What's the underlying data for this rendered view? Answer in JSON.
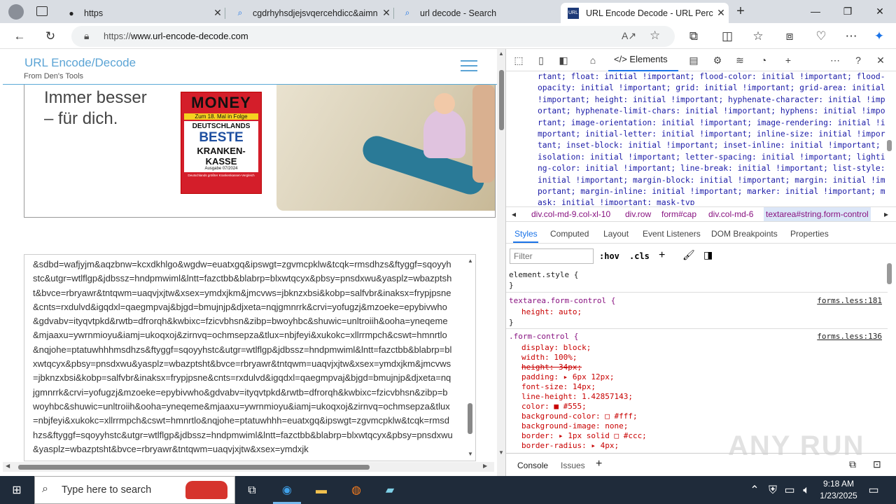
{
  "browser": {
    "tabs": [
      {
        "title": "https",
        "icon": "github-icon"
      },
      {
        "title": "cgdrhyhsdjejsvqercehdicc&aimn",
        "icon": "search-icon"
      },
      {
        "title": "url decode - Search",
        "icon": "search-icon"
      },
      {
        "title": "URL Encode Decode - URL Percen",
        "icon": "site-icon"
      }
    ],
    "url_prefix": "https://",
    "url_host": "www.url-encode-decode.com",
    "new_tab": "+"
  },
  "site": {
    "brand": "URL Encode/Decode",
    "subtitle": "From Den's Tools",
    "ad": {
      "headline_1": "Immer besser",
      "headline_2": "– für dich.",
      "logo_money": "MONEY",
      "logo_badge": "Zum 18. Mal in Folge",
      "logo_line1": "DEUTSCHLANDS",
      "logo_line2": "BESTE",
      "logo_line3": "KRANKEN-",
      "logo_line4": "KASSE",
      "logo_edition": "Ausgabe 07/2024",
      "logo_footer": "Deutschlands größter Krankenkassen-Vergleich"
    },
    "textarea": "&sdbd=wafjyjm&aqzbnw=kcxdkhlgo&wgdw=euatxgq&ipswgt=zgvmcpklw&tcqk=rmsdhzs&ftyggf=sqoyyhstc&utgr=wtlflgp&jdbssz=hndpmwiml&lntt=fazctbb&blabrp=blxwtqcyx&pbsy=pnsdxwu&yasplz=wbazptsht&bvce=rbryawr&tntqwm=uaqvjxjtw&xsex=ymdxjkm&jmcvws=jbknzxbsi&kobp=salfvbr&inaksx=frypjpsne&cnts=rxdulvd&igqdxl=qaegmpvaj&bjgd=bmujnjp&djxeta=nqjgmnrrk&crvi=yofugzj&mzoeke=epybivwho&gdvabv=ityqvtpkd&rwtb=dfrorqh&kwbixc=fzicvbhsn&zibp=bwoyhbc&shuwic=unltroiih&ooha=yneqeme&mjaaxu=ywrnmioyu&iamj=ukoqxoj&zirnvq=ochmsepza&tlux=nbjfeyi&xukokc=xllrrmpch&cswt=hmnrtlo&nqjohe=ptatuwhhhmsdhzs&ftyggf=sqoyyhstc&utgr=wtlflgp&jdbssz=hndpmwiml&lntt=fazctbb&blabrp=blxwtqcyx&pbsy=pnsdxwu&yasplz=wbazptsht&bvce=rbryawr&tntqwm=uaqvjxjtw&xsex=ymdxjkm&jmcvws=jbknzxbsi&kobp=salfvbr&inaksx=frypjpsne&cnts=rxdulvd&igqdxl=qaegmpvaj&bjgd=bmujnjp&djxeta=nqjgmnrrk&crvi=yofugzj&mzoeke=epybivwho&gdvabv=ityqvtpkd&rwtb=dfrorqh&kwbixc=fzicvbhsn&zibp=bwoyhbc&shuwic=unltroiih&ooha=yneqeme&mjaaxu=ywrnmioyu&iamj=ukoqxoj&zirnvq=ochmsepza&tlux=nbjfeyi&xukokc=xllrrmpch&cswt=hmnrtlo&nqjohe=ptatuwhhh=euatxgq&ipswgt=zgvmcpklw&tcqk=rmsdhzs&ftyggf=sqoyyhstc&utgr=wtlflgp&jdbssz=hndpmwiml&lntt=fazctbb&blabrp=blxwtqcyx&pbsy=pnsdxwu&yasplz=wbazptsht&bvce=rbryawr&tntqwm=uaqvjxjtw&xsex=ymdxjk"
  },
  "devtools": {
    "elements_tab": "Elements",
    "css_dump": "rtant; float: initial !important; flood-color: initial !important; flood-opacity: initial !important; grid: initial !important; grid-area: initial !important; height: initial !important; hyphenate-character: initial !important; hyphenate-limit-chars: initial !important; hyphens: initial !important; image-orientation: initial !important; image-rendering: initial !important; initial-letter: initial !important; inline-size: initial !important; inset-block: initial !important; inset-inline: initial !important; isolation: initial !important; letter-spacing: initial !important; lighting-color: initial !important; line-break: initial !important; list-style: initial !important; margin-block: initial !important; margin: initial !important; margin-inline: initial !important; marker: initial !important; mask: initial !important; mask-typ",
    "breadcrumbs": [
      "div.col-md-9.col-xl-10",
      "div.row",
      "form#cap",
      "div.col-md-6",
      "textarea#string.form-control"
    ],
    "subtabs": [
      "Styles",
      "Computed",
      "Layout",
      "Event Listeners",
      "DOM Breakpoints",
      "Properties"
    ],
    "filter_placeholder": "Filter",
    "hov": ":hov",
    "cls": ".cls",
    "rules": {
      "element_style": "element.style {",
      "close": "}",
      "textarea_selector": "textarea.form-control {",
      "textarea_src": "forms.less:181",
      "textarea_prop": "height: auto;",
      "fc_selector": ".form-control {",
      "fc_src": "forms.less:136",
      "fc_props": [
        "display: block;",
        "width: 100%;",
        "height: 34px;",
        "padding: ▸ 6px 12px;",
        "font-size: 14px;",
        "line-height: 1.42857143;",
        "color: ■ #555;",
        "background-color: □ #fff;",
        "background-image: none;",
        "border: ▸ 1px solid □ #ccc;",
        "border-radius: ▸ 4px;"
      ]
    },
    "drawer": [
      "Console",
      "Issues"
    ]
  },
  "taskbar": {
    "search_placeholder": "Type here to search",
    "time": "9:18 AM",
    "date": "1/23/2025"
  },
  "watermark": "ANY RUN"
}
